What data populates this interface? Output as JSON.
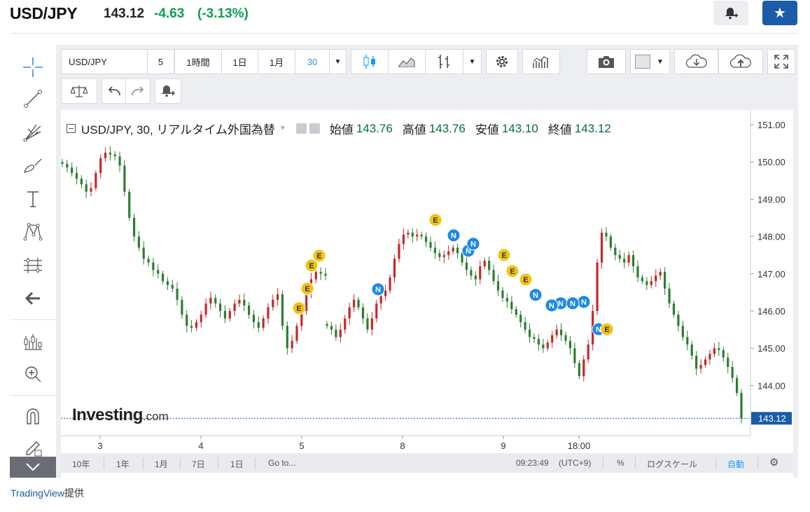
{
  "header": {
    "symbol": "USD/JPY",
    "price": "143.12",
    "change": "-4.63",
    "change_pct": "(-3.13%)",
    "colors": {
      "change": "#0e9f52",
      "star_button": "#1a5ca8"
    }
  },
  "toolbar": {
    "symbol_input": "USD/JPY",
    "intervals": [
      "5",
      "1時間",
      "1日",
      "1月",
      "30"
    ],
    "active_interval": "30"
  },
  "legend": {
    "title": "USD/JPY, 30, リアルタイム外国為替",
    "open_label": "始値",
    "open": "143.76",
    "high_label": "高値",
    "high": "143.76",
    "low_label": "安値",
    "low": "143.10",
    "close_label": "終値",
    "close": "143.12"
  },
  "watermark": {
    "brand": "Investing",
    "domain": ".com"
  },
  "bottom_bar": {
    "ranges": [
      "10年",
      "1年",
      "1月",
      "7日",
      "1日"
    ],
    "goto": "Go to...",
    "time": "09:23:49",
    "tz": "(UTC+9)",
    "percent": "%",
    "log_scale": "ログスケール",
    "auto": "自動"
  },
  "footer": {
    "provider": "TradingView",
    "suffix": "提供"
  },
  "chart_data": {
    "type": "candlestick",
    "title": "USD/JPY, 30, リアルタイム外国為替",
    "y_ticks": [
      "151.00",
      "150.00",
      "149.00",
      "148.00",
      "147.00",
      "146.00",
      "145.00",
      "144.00"
    ],
    "ylim": [
      143.6,
      151.2
    ],
    "x_ticks": [
      "3",
      "4",
      "5",
      "8",
      "9",
      "18:00"
    ],
    "last_price_label": "143.12",
    "colors": {
      "up": "#c62828",
      "down": "#2e7d32",
      "event_E": "#f2c40f",
      "event_N": "#1e88e5",
      "price_line": "#1a5ca8"
    },
    "series": [
      {
        "name": "",
        "values": [
          149.95,
          149.85,
          149.7,
          149.55,
          149.4,
          149.2,
          149.3,
          149.7,
          150.1,
          150.25,
          150.2,
          150.15,
          149.9,
          149.2,
          148.5,
          148.0,
          147.7,
          147.4,
          147.3,
          147.1,
          147.0,
          146.8,
          146.7,
          146.6,
          146.3,
          145.9,
          145.6,
          145.55,
          145.7,
          145.9,
          146.2,
          146.35,
          146.2,
          146.0,
          145.8,
          146.0,
          146.2,
          146.3,
          146.15,
          145.9,
          145.7,
          145.55,
          145.8,
          146.1,
          146.3,
          146.45,
          145.6,
          145.0,
          145.2,
          145.6,
          146.0,
          146.5,
          146.85,
          147.05,
          147.0,
          146.95
        ]
      },
      {
        "name": "",
        "values": [
          145.6,
          145.5,
          145.3,
          145.5,
          145.8,
          146.1,
          146.3,
          146.1,
          145.8,
          145.5,
          145.8,
          146.2,
          146.4,
          146.55,
          146.9,
          147.4,
          147.8,
          148.05,
          148.1,
          148.0,
          148.05,
          148.0,
          147.85,
          147.7,
          147.55,
          147.45,
          147.5,
          147.6,
          147.7,
          147.55,
          147.3,
          147.1,
          146.95,
          146.85,
          147.2,
          147.35,
          147.1,
          146.8,
          146.55,
          146.35,
          146.25,
          146.05,
          145.9,
          145.7,
          145.5,
          145.3,
          145.25,
          145.1,
          145.0,
          145.15,
          145.35,
          145.5,
          145.35,
          145.2,
          145.0,
          144.6,
          144.25,
          144.7,
          145.1,
          146.0,
          147.3,
          148.1,
          148.0,
          147.7,
          147.5,
          147.4,
          147.3,
          147.5,
          147.2,
          146.9,
          146.8,
          146.7,
          146.8,
          146.95,
          147.05,
          146.6,
          146.2,
          145.9,
          145.6,
          145.3,
          145.1,
          144.8,
          144.45,
          144.55,
          144.7,
          144.85,
          145.0,
          144.95,
          144.75,
          144.5,
          144.2,
          143.8,
          143.12
        ]
      }
    ],
    "events": [
      "E",
      "E",
      "E",
      "E",
      "E",
      "N",
      "N",
      "N",
      "N",
      "N",
      "N",
      "E",
      "E",
      "E",
      "E",
      "N",
      "N",
      "N",
      "N",
      "E"
    ]
  }
}
